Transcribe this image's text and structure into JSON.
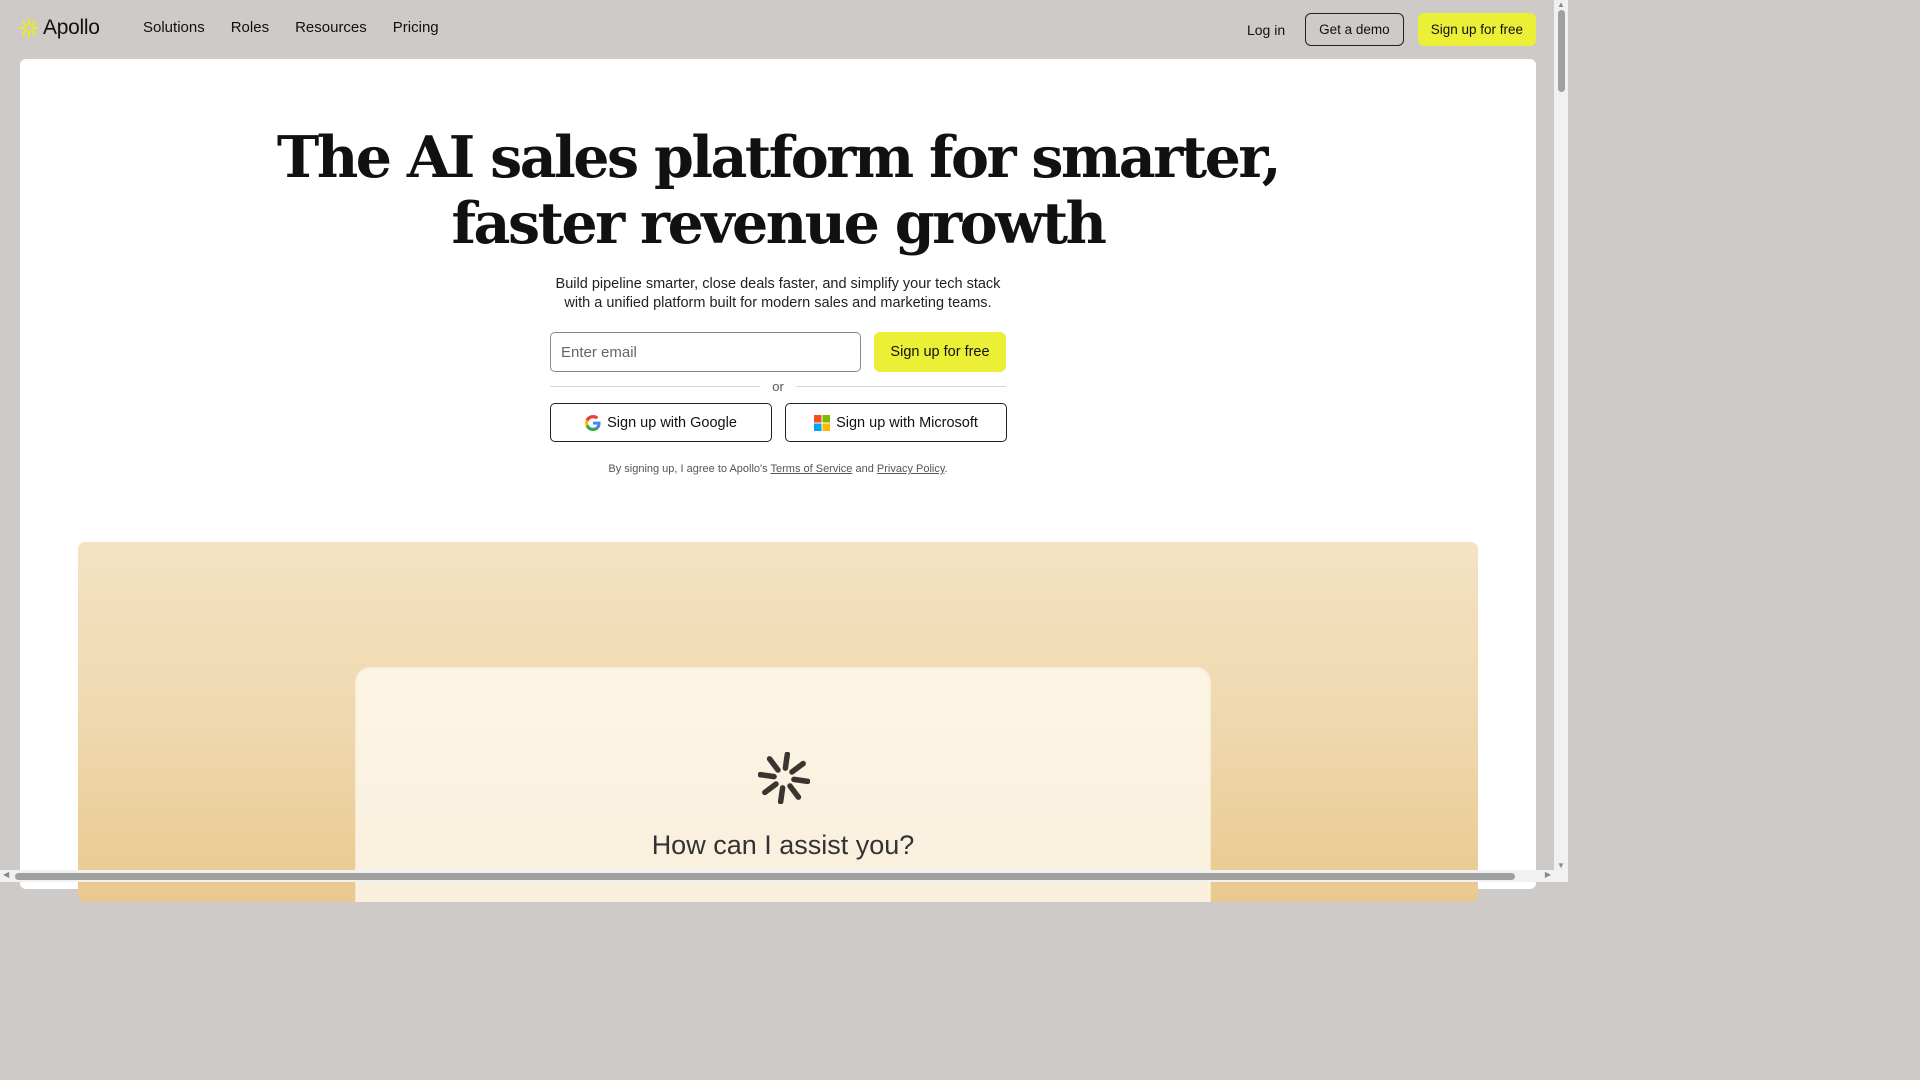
{
  "brand": {
    "name": "Apollo",
    "accent": "#ebf036"
  },
  "nav": {
    "links": [
      "Solutions",
      "Roles",
      "Resources",
      "Pricing"
    ],
    "login": "Log in",
    "demo": "Get a demo",
    "signup": "Sign up for free"
  },
  "hero": {
    "title_line1": "The AI sales platform for smarter,",
    "title_line2": "faster revenue growth",
    "subtitle_line1": "Build pipeline smarter, close deals faster, and simplify your tech stack",
    "subtitle_line2": "with a unified platform built for modern sales and marketing teams.",
    "email_placeholder": "Enter email",
    "signup_button": "Sign up for free",
    "or": "or",
    "google_button": "Sign up with Google",
    "microsoft_button": "Sign up with Microsoft",
    "legal_prefix": "By signing up, I agree to Apollo's ",
    "terms": "Terms of Service",
    "legal_and": " and ",
    "privacy": "Privacy Policy",
    "legal_suffix": "."
  },
  "assistant": {
    "prompt": "How can I assist you?"
  }
}
